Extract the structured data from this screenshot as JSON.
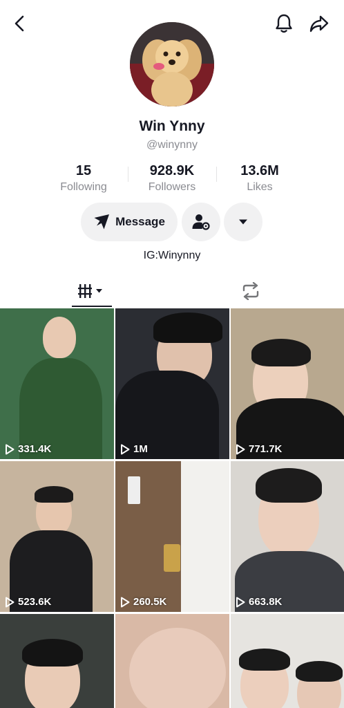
{
  "header": {
    "back_icon": "chevron-left-icon",
    "bell_icon": "bell-icon",
    "share_icon": "share-icon"
  },
  "profile": {
    "display_name": "Win Ynny",
    "username": "@winynny",
    "bio": "IG:Winynny"
  },
  "stats": {
    "following": {
      "value": "15",
      "label": "Following"
    },
    "followers": {
      "value": "928.9K",
      "label": "Followers"
    },
    "likes": {
      "value": "13.6M",
      "label": "Likes"
    }
  },
  "actions": {
    "message_label": "Message",
    "message_icon": "send-icon",
    "add_friend_icon": "person-settings-icon",
    "more_icon": "caret-down-icon"
  },
  "tabs": {
    "videos_icon": "grid-bars-icon",
    "reposts_icon": "repost-icon"
  },
  "videos": [
    {
      "views": "331.4K",
      "bg": "#3f6f4a"
    },
    {
      "views": "1M",
      "bg": "#2b2d33"
    },
    {
      "views": "771.7K",
      "bg": "#b8a88f"
    },
    {
      "views": "523.6K",
      "bg": "#c6b49e"
    },
    {
      "views": "260.5K",
      "bg": "#7a5e47"
    },
    {
      "views": "663.8K",
      "bg": "#d9d6d1"
    },
    {
      "views": "",
      "bg": "#3a3f3c"
    },
    {
      "views": "",
      "bg": "#d9b9a6"
    },
    {
      "views": "",
      "bg": "#e6e4e0"
    }
  ]
}
